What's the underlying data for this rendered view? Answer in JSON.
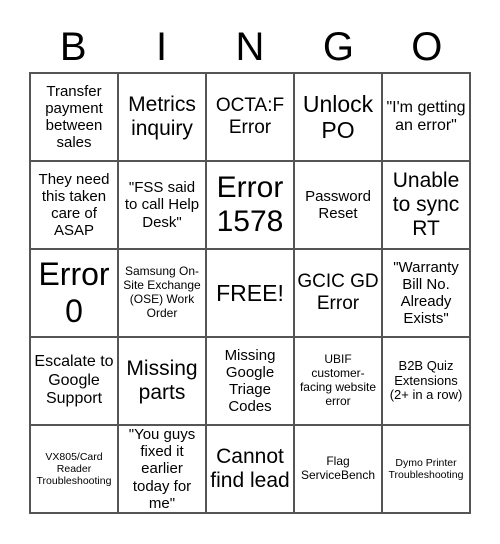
{
  "header": [
    "B",
    "I",
    "N",
    "G",
    "O"
  ],
  "cells": [
    {
      "text": "Transfer payment between sales",
      "size": "s15"
    },
    {
      "text": "Metrics inquiry",
      "size": "s21"
    },
    {
      "text": "OCTA:F Error",
      "size": "s19"
    },
    {
      "text": "Unlock PO",
      "size": "s23"
    },
    {
      "text": "\"I'm getting an error\"",
      "size": "s16"
    },
    {
      "text": "They need this taken care of ASAP",
      "size": "s15"
    },
    {
      "text": "\"FSS said to call Help Desk\"",
      "size": "s15"
    },
    {
      "text": "Error 1578",
      "size": "s30"
    },
    {
      "text": "Password Reset",
      "size": "s15"
    },
    {
      "text": "Unable to sync RT",
      "size": "s21"
    },
    {
      "text": "Error 0",
      "size": "s32"
    },
    {
      "text": "Samsung On-Site Exchange (OSE) Work Order",
      "size": "s12"
    },
    {
      "text": "FREE!",
      "size": "s23"
    },
    {
      "text": "GCIC GD Error",
      "size": "s19"
    },
    {
      "text": "\"Warranty Bill No. Already Exists\"",
      "size": "s15"
    },
    {
      "text": "Escalate to Google Support",
      "size": "s16"
    },
    {
      "text": "Missing parts",
      "size": "s21"
    },
    {
      "text": "Missing Google Triage Codes",
      "size": "s15"
    },
    {
      "text": "UBIF customer-facing website error",
      "size": "s12"
    },
    {
      "text": "B2B Quiz Extensions (2+ in a row)",
      "size": "s13"
    },
    {
      "text": "VX805/Card Reader Troubleshooting",
      "size": "s11"
    },
    {
      "text": "\"You guys fixed it earlier today for me\"",
      "size": "s15"
    },
    {
      "text": "Cannot find lead",
      "size": "s21"
    },
    {
      "text": "Flag ServiceBench",
      "size": "s12"
    },
    {
      "text": "Dymo Printer Troubleshooting",
      "size": "s11"
    }
  ]
}
